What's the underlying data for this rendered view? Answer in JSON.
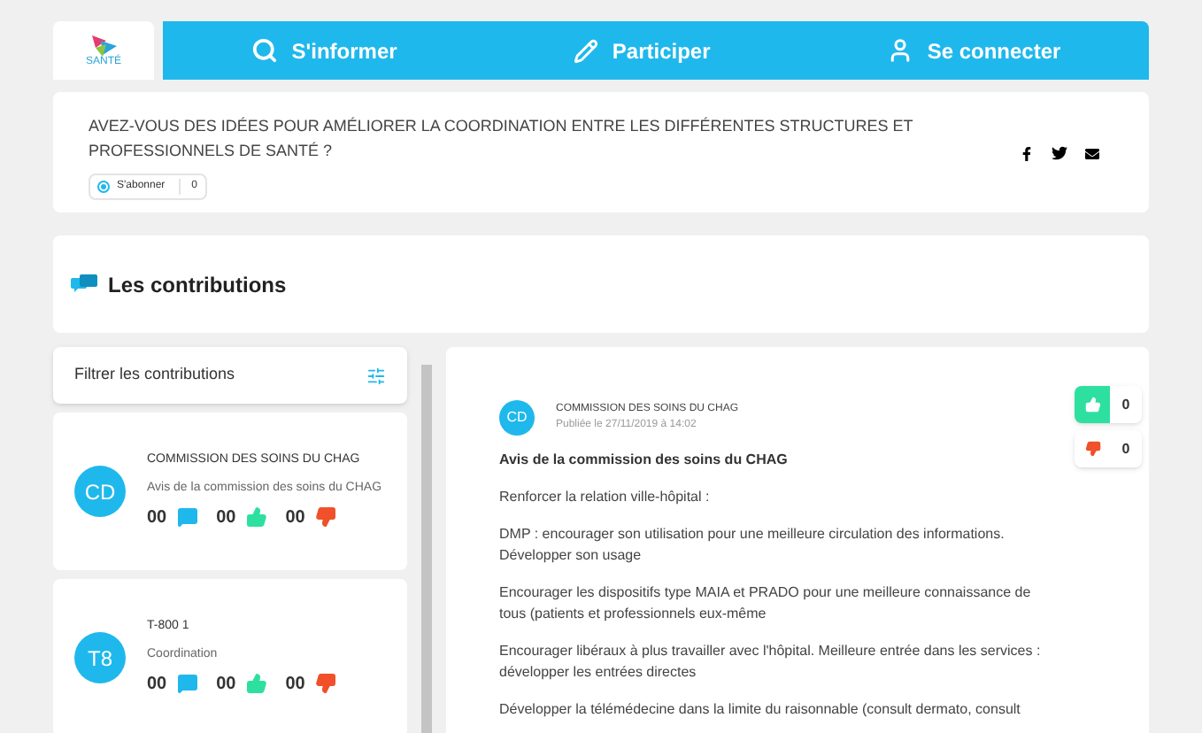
{
  "header": {
    "logo_text": "SANTÉ",
    "nav": [
      {
        "label": "S'informer"
      },
      {
        "label": "Participer"
      },
      {
        "label": "Se connecter"
      }
    ]
  },
  "question": {
    "title": "AVEZ-VOUS DES IDÉES POUR AMÉLIORER LA COORDINATION ENTRE LES DIFFÉRENTES STRUCTURES ET PROFESSIONNELS DE SANTÉ ?",
    "subscribe": {
      "label": "S'abonner",
      "count": "0"
    }
  },
  "contributions_title": "Les contributions",
  "filter": {
    "label": "Filtrer les contributions"
  },
  "items": [
    {
      "initials": "CD",
      "author": "COMMISSION DES SOINS DU CHAG",
      "title": "Avis de la commission des soins du CHAG",
      "comments": "00",
      "likes": "00",
      "dislikes": "00"
    },
    {
      "initials": "T8",
      "author": "T-800 1",
      "title": "Coordination",
      "comments": "00",
      "likes": "00",
      "dislikes": "00"
    }
  ],
  "detail": {
    "initials": "CD",
    "author": "COMMISSION DES SOINS DU CHAG",
    "date": "Publiée le 27/11/2019 à 14:02",
    "likes": "0",
    "dislikes": "0",
    "heading": "Avis de la commission des soins du CHAG",
    "paragraphs": [
      "Renforcer la relation ville-hôpital :",
      "DMP : encourager son utilisation pour une meilleure circulation des informations. Développer son usage",
      "Encourager les dispositifs type MAIA et PRADO pour une meilleure connaissance de tous (patients et professionnels eux-même",
      "Encourager libéraux à plus travailler avec l'hôpital. Meilleure entrée dans les services : développer les entrées directes",
      "Développer la télémédecine dans la limite du raisonnable (consult dermato, consult"
    ]
  }
}
